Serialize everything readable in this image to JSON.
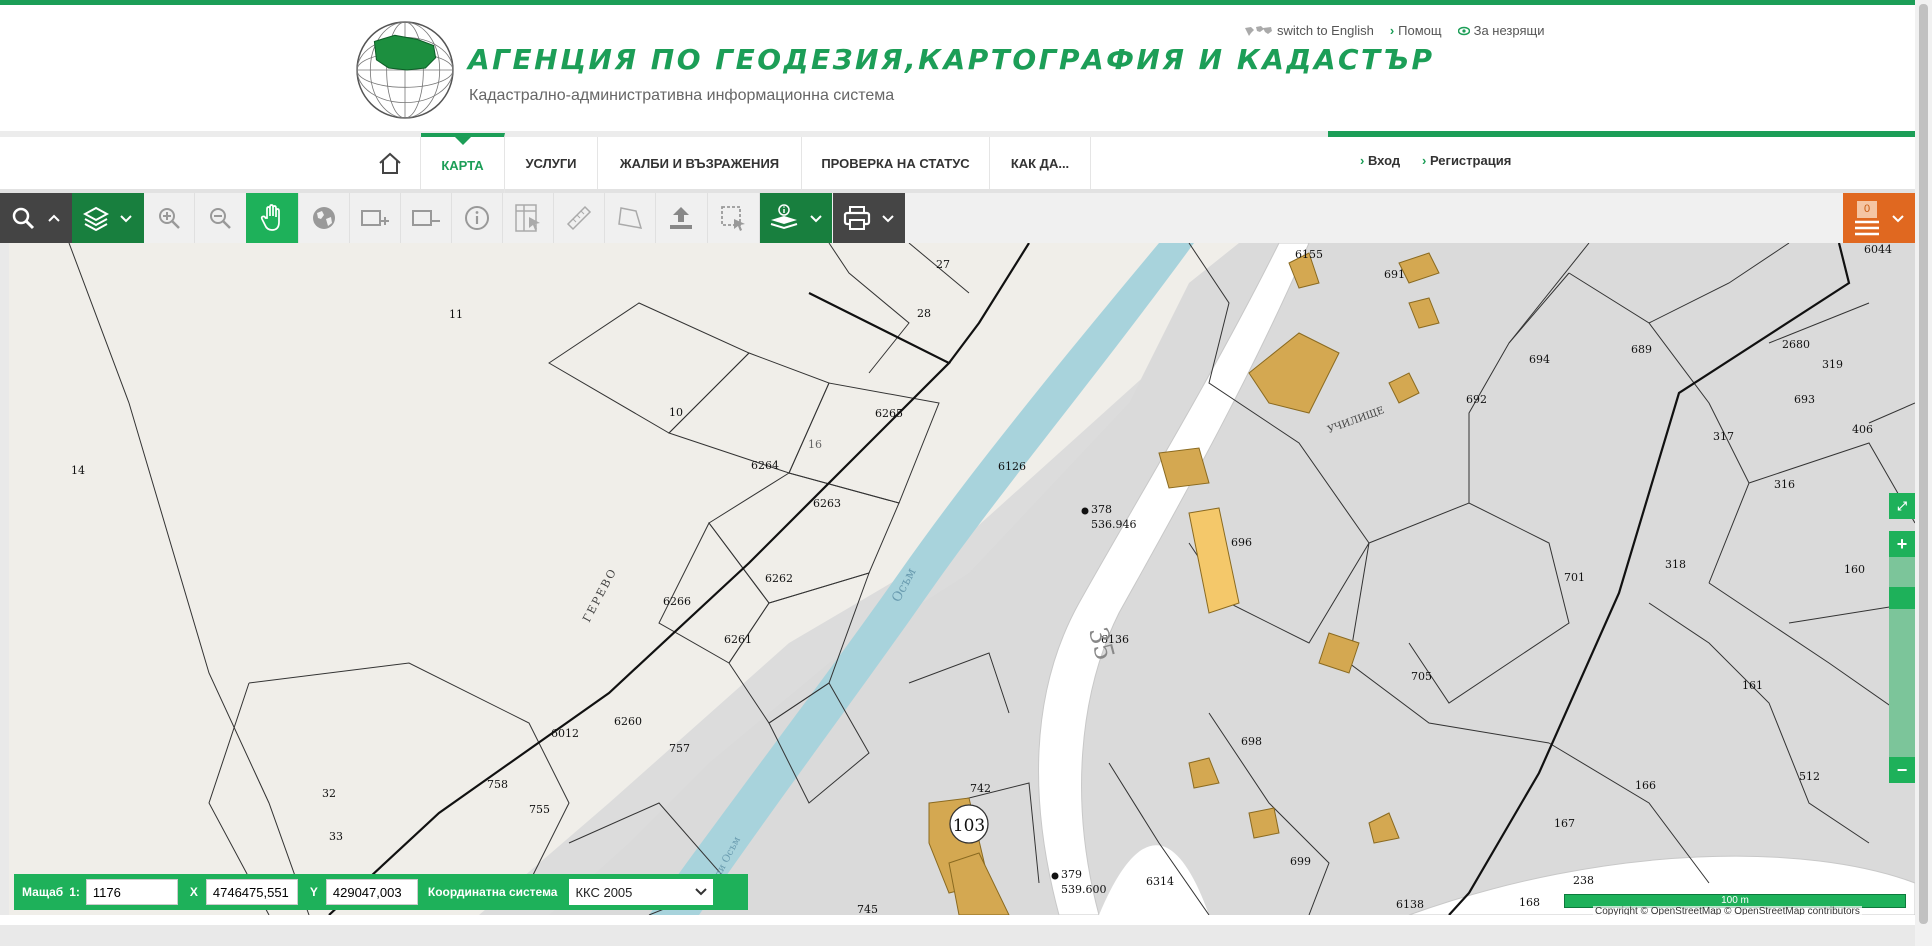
{
  "header": {
    "title": "АГЕНЦИЯ ПО ГЕОДЕЗИЯ,КАРТОГРАФИЯ И КАДАСТЪР",
    "subtitle": "Кадастрално-административна информационна система",
    "links": [
      {
        "label": "switch to English",
        "icon": "world-map-icon"
      },
      {
        "label": "Помощ",
        "icon": "chevron-right-icon"
      },
      {
        "label": "За незрящи",
        "icon": "eye-icon"
      }
    ]
  },
  "nav": {
    "home_icon": "home-icon",
    "items": [
      "КАРТА",
      "УСЛУГИ",
      "ЖАЛБИ И ВЪЗРАЖЕНИЯ",
      "ПРОВЕРКА НА СТАТУС",
      "КАК ДА..."
    ],
    "active": "КАРТА",
    "login": "Вход",
    "register": "Регистрация"
  },
  "toolbar": {
    "tools": [
      "search-icon",
      "layers-icon",
      "zoom-in-icon",
      "zoom-out-icon",
      "pan-hand-icon",
      "globe-icon",
      "add-rect-icon",
      "remove-rect-icon",
      "info-icon",
      "table-select-icon",
      "ruler-icon",
      "polygon-icon",
      "upload-icon",
      "select-area-icon",
      "layer-info-icon",
      "print-icon"
    ],
    "active_tool": "pan-hand-icon",
    "cart_count": "0"
  },
  "coords": {
    "scale_label": "Мащаб",
    "scale_prefix": "1:",
    "scale_value": "1176",
    "x_label": "X",
    "x_value": "4746475,551",
    "y_label": "Y",
    "y_value": "429047,003",
    "system_label": "Координатна система",
    "system_value": "ККС 2005"
  },
  "map": {
    "parcel_labels": [
      "27",
      "28",
      "11",
      "10",
      "6265",
      "16",
      "14",
      "6264",
      "6263",
      "6126",
      "6155",
      "691",
      "694",
      "689",
      "2680",
      "319",
      "6044",
      "692",
      "693",
      "406",
      "317",
      "316",
      "696",
      "701",
      "318",
      "160",
      "6262",
      "6266",
      "6261",
      "6136",
      "705",
      "161",
      "6260",
      "6012",
      "757",
      "742",
      "698",
      "166",
      "512",
      "32",
      "758",
      "33",
      "755",
      "167",
      "745",
      "6314",
      "699",
      "6138",
      "238",
      "168"
    ],
    "road_number": "35",
    "river_labels": [
      "Осъм",
      "р.Бели Осъм"
    ],
    "street_label": "ГЕРЕВО",
    "poi_label": "УЧИЛИЩЕ",
    "benchmarks": [
      {
        "id": "378",
        "elev": "536.946"
      },
      {
        "id": "379",
        "elev": "539.600"
      }
    ],
    "block_number": "103",
    "scale_text": "100 m",
    "copyright": "Copyright © OpenStreetMap © OpenStreetMap contributors"
  },
  "colors": {
    "brand_green": "#1c9e57",
    "building": "#d4a851",
    "river": "#a8d3dc",
    "road": "#ffffff",
    "parcel_fill": "#dcdcdc"
  }
}
